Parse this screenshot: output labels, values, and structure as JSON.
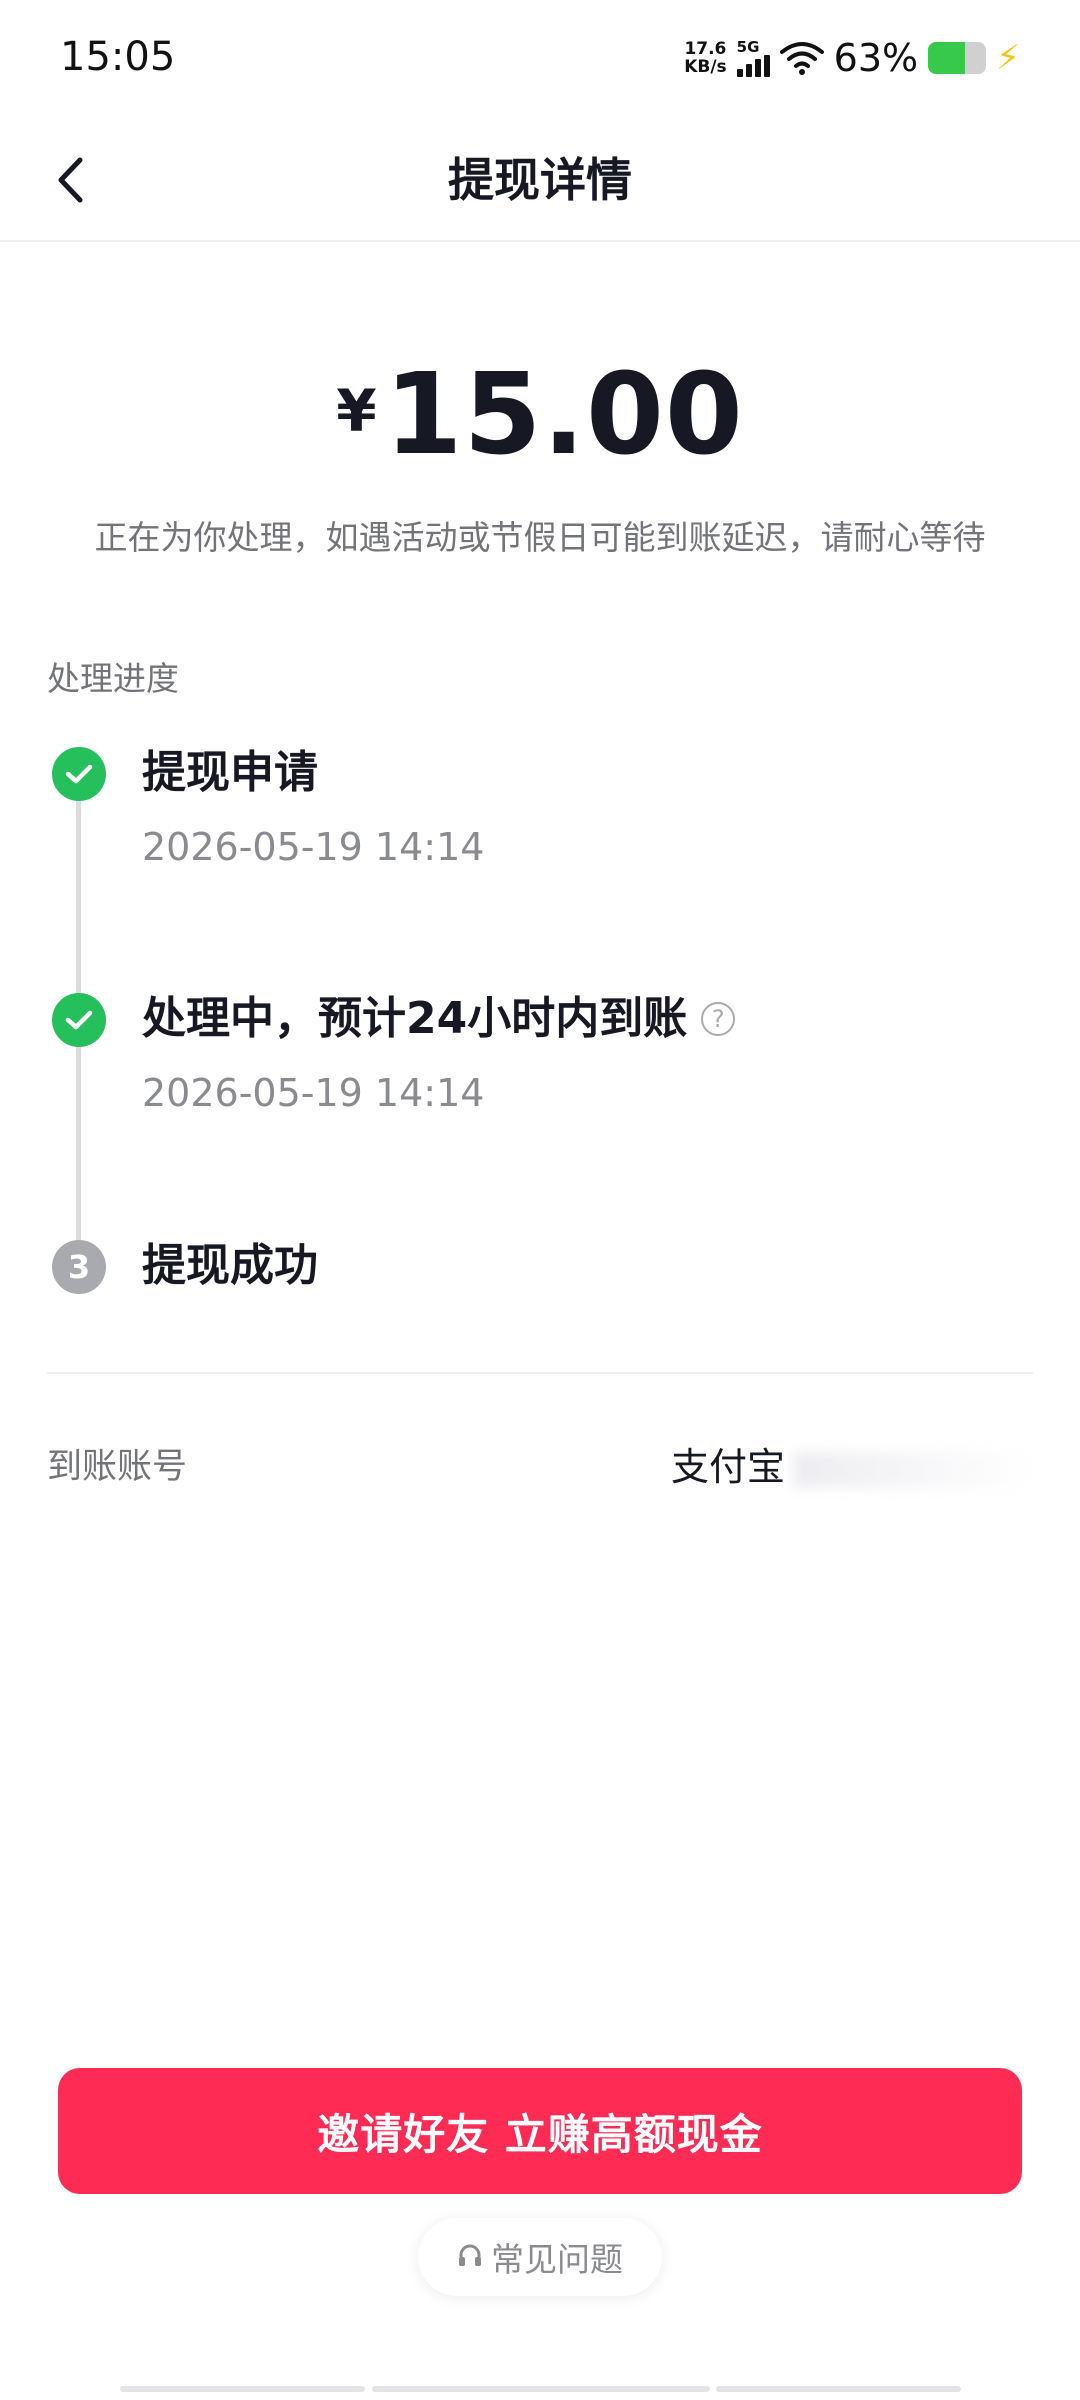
{
  "status_bar": {
    "time": "15:05",
    "net_speed_value": "17.6",
    "net_speed_unit": "KB/s",
    "network_type": "5G",
    "battery_percent": "63%",
    "battery_level": 0.63,
    "battery_color": "#36c94b"
  },
  "header": {
    "title": "提现详情",
    "back_icon": "chevron-left-icon"
  },
  "amount": {
    "currency": "¥",
    "value": "15.00"
  },
  "notice": "正在为你处理，如遇活动或节假日可能到账延迟，请耐心等待",
  "progress": {
    "label": "处理进度",
    "steps": [
      {
        "title": "提现申请",
        "time": "2026-05-19 14:14",
        "status": "done"
      },
      {
        "title": "处理中，预计24小时内到账",
        "time": "2026-05-19 14:14",
        "status": "done",
        "help_icon": "question-circle-icon"
      },
      {
        "title": "提现成功",
        "index": "3",
        "status": "pending"
      }
    ],
    "done_color": "#25c05c",
    "pending_color": "#a9aab0"
  },
  "account": {
    "label": "到账账号",
    "value_prefix": "支付宝"
  },
  "cta": {
    "label": "邀请好友 立赚高额现金",
    "color": "#fe2c55"
  },
  "faq": {
    "label": "常见问题",
    "icon": "headset-icon"
  }
}
